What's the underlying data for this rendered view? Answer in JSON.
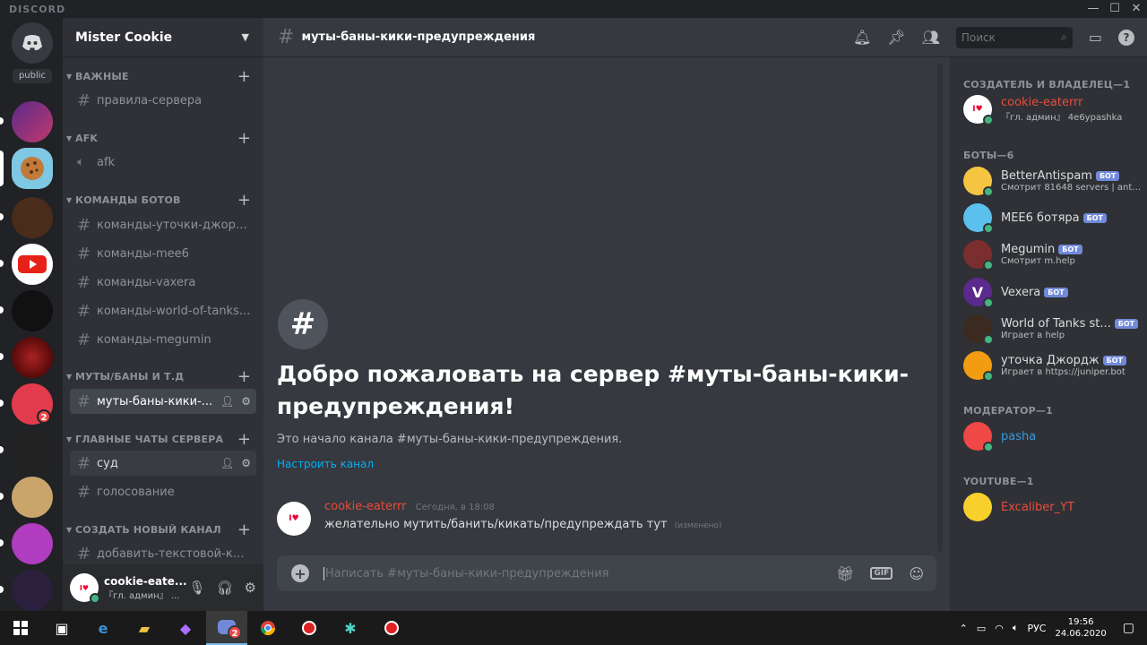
{
  "window": {
    "brand": "DISCORD",
    "min": "—",
    "max": "☐",
    "close": "✕"
  },
  "guilds": {
    "public_label": "public",
    "badge_2": "2"
  },
  "server": {
    "name": "Mister Cookie"
  },
  "categories": [
    {
      "label": "ВАЖНЫЕ"
    },
    {
      "label": "AFK"
    },
    {
      "label": "КОМАНДЫ БОТОВ"
    },
    {
      "label": "МУТЫ/БАНЫ И Т.Д"
    },
    {
      "label": "ГЛАВНЫЕ ЧАТЫ СЕРВЕРА"
    },
    {
      "label": "СОЗДАТЬ НОВЫЙ КАНАЛ"
    }
  ],
  "channels": [
    {
      "name": "правила-сервера"
    },
    {
      "name": "afk"
    },
    {
      "name": "команды-уточки-джордж..."
    },
    {
      "name": "команды-mee6"
    },
    {
      "name": "команды-vaxera"
    },
    {
      "name": "команды-world-of-tanks..."
    },
    {
      "name": "команды-megumin"
    },
    {
      "name": "муты-баны-кики-..."
    },
    {
      "name": "суд"
    },
    {
      "name": "голосование"
    },
    {
      "name": "добавить-текстовой-ка..."
    }
  ],
  "user": {
    "name": "cookie-eate...",
    "tag": "『гл. админ』 ..."
  },
  "header": {
    "title": "муты-баны-кики-предупреждения",
    "search_placeholder": "Поиск"
  },
  "welcome": {
    "title": "Добро пожаловать на сервер #муты-баны-кики-предупреждения!",
    "subtitle": "Это начало канала #муты-баны-кики-предупреждения.",
    "link": "Настроить канал"
  },
  "message": {
    "author": "cookie-eaterrr",
    "time": "Сегодня, в 18:08",
    "text": "желательно мутить/банить/кикать/предупреждать тут",
    "edited": "(изменено)"
  },
  "composer": {
    "placeholder": "Написать #муты-баны-кики-предупреждения",
    "gif": "GIF"
  },
  "members": {
    "groups": [
      "СОЗДАТЕЛЬ И ВЛАДЕЛЕЦ—1",
      "БОТЫ—6",
      "МОДЕРАТОР—1",
      "YOUTUBE—1"
    ],
    "bot_label": "БОТ",
    "list": [
      {
        "name": "cookie-eaterrr",
        "activity": "『гл. админ』 4е6урashka",
        "color": "#e74c3c"
      },
      {
        "name": "BetterAntispam",
        "activity": "Смотрит 81648 servers | anti...",
        "color": "#dcddde"
      },
      {
        "name": "MEE6 ботяра",
        "activity": "",
        "color": "#dcddde"
      },
      {
        "name": "Megumin",
        "activity": "Смотрит m.help",
        "color": "#dcddde"
      },
      {
        "name": "Vexera",
        "activity": "",
        "color": "#dcddde"
      },
      {
        "name": "World of Tanks st...",
        "activity": "Играет в help",
        "color": "#dcddde"
      },
      {
        "name": "уточка Джордж",
        "activity": "Играет в https://juniper.bot",
        "color": "#dcddde"
      },
      {
        "name": "pasha",
        "activity": "",
        "color": "#3498db"
      },
      {
        "name": "Excaliber_YT",
        "activity": "",
        "color": "#e74c3c"
      }
    ]
  },
  "taskbar": {
    "lang": "РУС",
    "time": "19:56",
    "date": "24.06.2020",
    "badge": "2"
  }
}
